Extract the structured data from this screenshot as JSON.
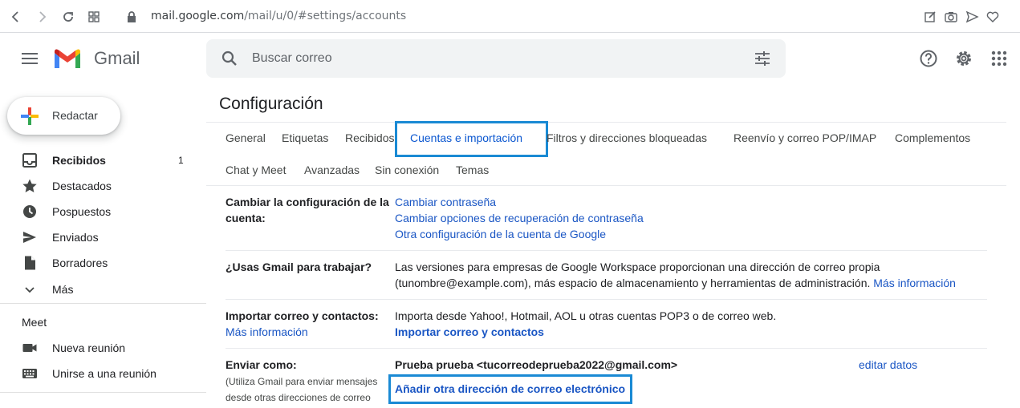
{
  "browser": {
    "url_domain": "mail.google.com",
    "url_path": "/mail/u/0/#settings/accounts"
  },
  "header": {
    "brand": "Gmail",
    "search_placeholder": "Buscar correo"
  },
  "sidebar": {
    "compose_label": "Redactar",
    "items": [
      {
        "label": "Recibidos",
        "count": "1"
      },
      {
        "label": "Destacados"
      },
      {
        "label": "Pospuestos"
      },
      {
        "label": "Enviados"
      },
      {
        "label": "Borradores"
      },
      {
        "label": "Más"
      }
    ],
    "meet": {
      "title": "Meet",
      "items": [
        {
          "label": "Nueva reunión"
        },
        {
          "label": "Unirse a una reunión"
        }
      ]
    }
  },
  "settings": {
    "title": "Configuración",
    "tabs": [
      {
        "label": "General"
      },
      {
        "label": "Etiquetas"
      },
      {
        "label": "Recibidos"
      },
      {
        "label": "Cuentas e importación"
      },
      {
        "label": "Filtros y direcciones bloqueadas"
      },
      {
        "label": "Reenvío y correo POP/IMAP"
      },
      {
        "label": "Complementos"
      },
      {
        "label": "Chat y Meet"
      },
      {
        "label": "Avanzadas"
      },
      {
        "label": "Sin conexión"
      },
      {
        "label": "Temas"
      }
    ],
    "sections": {
      "account": {
        "label_line1": "Cambiar la configuración de la",
        "label_line2": "cuenta:",
        "links": [
          "Cambiar contraseña",
          "Cambiar opciones de recuperación de contraseña",
          "Otra configuración de la cuenta de Google"
        ]
      },
      "work": {
        "label": "¿Usas Gmail para trabajar?",
        "text_line1": "Las versiones para empresas de Google Workspace proporcionan una dirección de correo propia",
        "text_line2": "(tunombre@example.com), más espacio de almacenamiento y herramientas de administración.",
        "more_link": "Más información"
      },
      "import": {
        "label": "Importar correo y contactos:",
        "more_link": "Más información",
        "text": "Importa desde Yahoo!, Hotmail, AOL u otras cuentas POP3 o de correo web.",
        "action_link": "Importar correo y contactos"
      },
      "send_as": {
        "label": "Enviar como:",
        "note_line1": "(Utiliza Gmail para enviar mensajes",
        "note_line2": "desde otras direcciones de correo",
        "address": "Prueba prueba <tucorreodeprueba2022@gmail.com>",
        "edit_link": "editar datos",
        "add_link": "Añadir otra dirección de correo electrónico"
      }
    }
  },
  "colors": {
    "highlight_box": "#1a8ad4",
    "link": "#1a56c4",
    "active_tab": "#0b57d0"
  }
}
